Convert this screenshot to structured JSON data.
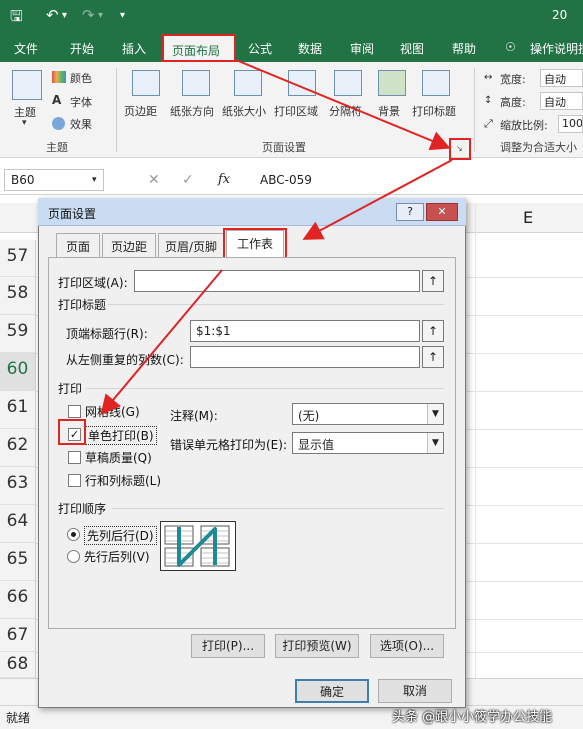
{
  "titlebar": {
    "title": "20"
  },
  "menu": {
    "items": [
      "文件",
      "开始",
      "插入",
      "页面布局",
      "公式",
      "数据",
      "审阅",
      "视图",
      "帮助"
    ],
    "tell_me": "操作说明搜"
  },
  "ribbon": {
    "theme_group": {
      "theme": "主题",
      "colors": "颜色",
      "fonts": "字体",
      "effects": "效果",
      "name": "主题"
    },
    "page_setup_group": {
      "margins": "页边距",
      "orientation": "纸张方向",
      "size": "纸张大小",
      "print_area": "打印区域",
      "breaks": "分隔符",
      "background": "背景",
      "print_titles": "打印标题",
      "name": "页面设置"
    },
    "scale_group": {
      "width_label": "宽度:",
      "width_value": "自动",
      "height_label": "高度:",
      "height_value": "自动",
      "scale_label": "缩放比例:",
      "scale_value": "100",
      "name": "调整为合适大小"
    }
  },
  "formula_bar": {
    "name_box": "B60",
    "value": "ABC-059",
    "fx": "fx"
  },
  "grid": {
    "column_e": "E",
    "rows": [
      "57",
      "58",
      "59",
      "60",
      "61",
      "62",
      "63",
      "64",
      "65",
      "66",
      "67",
      "68"
    ]
  },
  "status": {
    "ready": "就绪"
  },
  "dialog": {
    "title": "页面设置",
    "help": "?",
    "tabs": [
      "页面",
      "页边距",
      "页眉/页脚",
      "工作表"
    ],
    "print_area_label": "打印区域(A):",
    "print_area_value": "",
    "print_titles_section": "打印标题",
    "rows_repeat_label": "顶端标题行(R):",
    "rows_repeat_value": "$1:$1",
    "cols_repeat_label": "从左侧重复的列数(C):",
    "cols_repeat_value": "",
    "print_section": "打印",
    "gridlines": "网格线(G)",
    "bw": "单色打印(B)",
    "draft": "草稿质量(Q)",
    "headings": "行和列标题(L)",
    "comments_label": "注释(M):",
    "comments_value": "(无)",
    "errors_label": "错误单元格打印为(E):",
    "errors_value": "显示值",
    "order_section": "打印顺序",
    "down_then_over": "先列后行(D)",
    "over_then_down": "先行后列(V)",
    "print_btn": "打印(P)...",
    "preview_btn": "打印预览(W)",
    "options_btn": "选项(O)...",
    "ok_btn": "确定",
    "cancel_btn": "取消",
    "checks": {
      "gridlines": false,
      "bw": true,
      "draft": false,
      "headings": false
    },
    "order": "down_then_over"
  },
  "watermark": "头条 @跟小小筱学办公技能",
  "colors": {
    "excel_green": "#217346",
    "annotation_red": "#e02424"
  }
}
